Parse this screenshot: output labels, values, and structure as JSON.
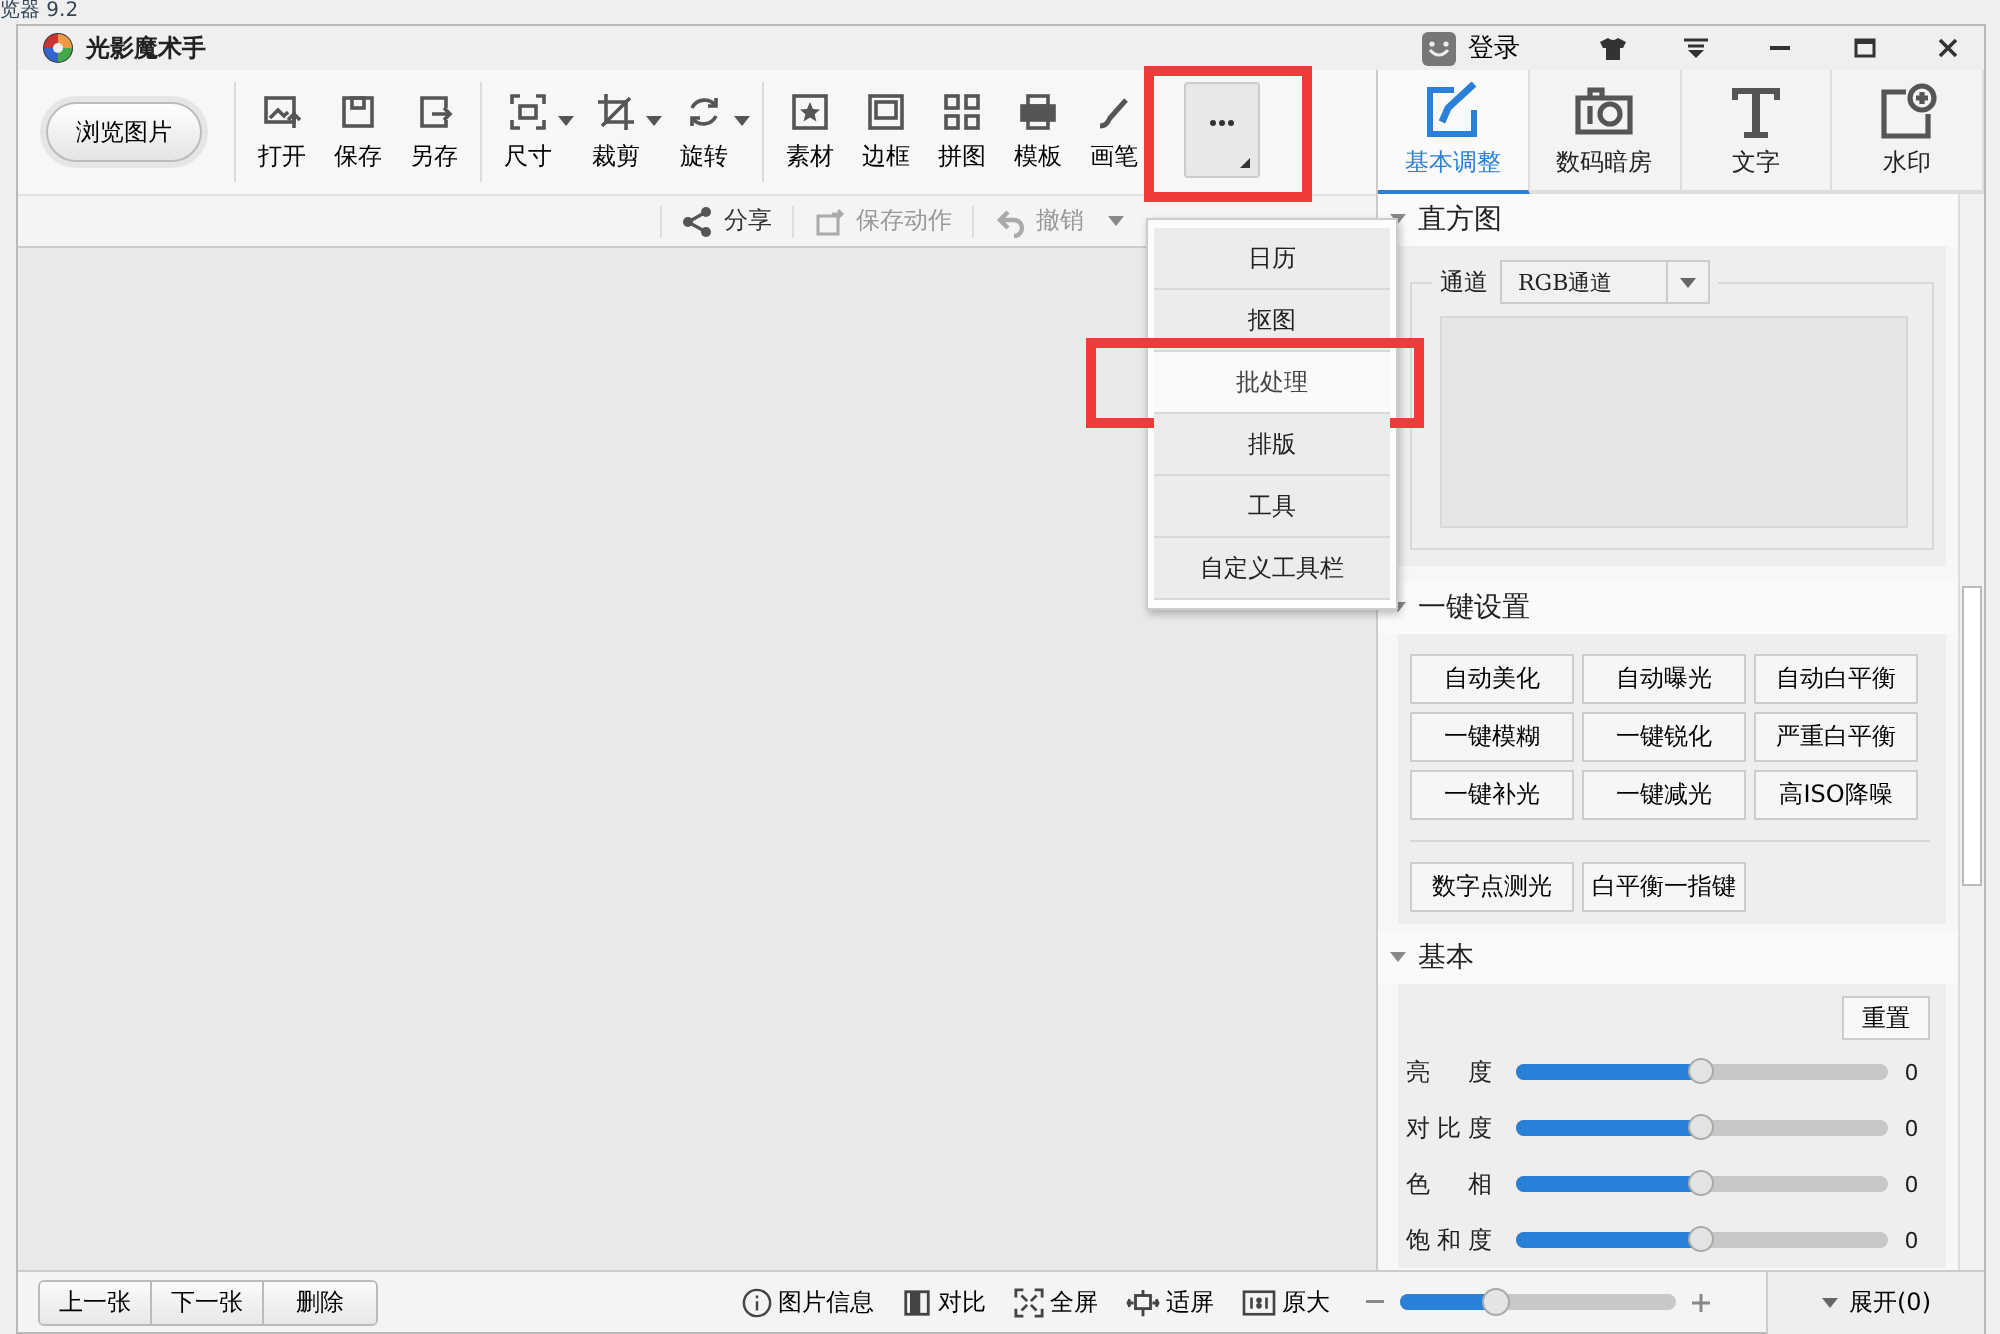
{
  "background_app": {
    "title_fragment": "览器 9.2"
  },
  "window": {
    "title": "光影魔术手",
    "login": "登录"
  },
  "browse_button": "浏览图片",
  "toolbar_groups": [
    [
      {
        "label": "打开",
        "kind": "open",
        "dropdown": false
      },
      {
        "label": "保存",
        "kind": "save",
        "dropdown": false
      },
      {
        "label": "另存",
        "kind": "saveas",
        "dropdown": false
      }
    ],
    [
      {
        "label": "尺寸",
        "kind": "size",
        "dropdown": true
      },
      {
        "label": "裁剪",
        "kind": "crop",
        "dropdown": true
      },
      {
        "label": "旋转",
        "kind": "rotate",
        "dropdown": true
      }
    ],
    [
      {
        "label": "素材",
        "kind": "star",
        "dropdown": false
      },
      {
        "label": "边框",
        "kind": "frame",
        "dropdown": false
      },
      {
        "label": "拼图",
        "kind": "grid",
        "dropdown": false
      },
      {
        "label": "模板",
        "kind": "printer",
        "dropdown": false
      },
      {
        "label": "画笔",
        "kind": "brush",
        "dropdown": false
      }
    ]
  ],
  "more_button": {
    "annotated": true
  },
  "side_tabs": [
    {
      "label": "基本调整",
      "kind": "edit",
      "selected": true
    },
    {
      "label": "数码暗房",
      "kind": "camera",
      "selected": false
    },
    {
      "label": "文字",
      "kind": "text",
      "selected": false
    },
    {
      "label": "水印",
      "kind": "watermark",
      "selected": false
    }
  ],
  "secondary_toolbar": [
    {
      "label": "分享",
      "kind": "share",
      "disabled": false,
      "dropdown": false
    },
    {
      "label": "保存动作",
      "kind": "saveaction",
      "disabled": true,
      "dropdown": false
    },
    {
      "label": "撤销",
      "kind": "undo",
      "disabled": true,
      "dropdown": true
    }
  ],
  "menu": [
    {
      "label": "日历",
      "hovered": false,
      "annotated": false
    },
    {
      "label": "抠图",
      "hovered": false,
      "annotated": false
    },
    {
      "label": "批处理",
      "hovered": true,
      "annotated": true
    },
    {
      "label": "排版",
      "hovered": false,
      "annotated": false
    },
    {
      "label": "工具",
      "hovered": false,
      "annotated": false
    },
    {
      "label": "自定义工具栏",
      "hovered": false,
      "annotated": false
    }
  ],
  "histogram": {
    "title": "直方图",
    "expanded": true,
    "channel_label": "通道",
    "channel_value": "RGB通道"
  },
  "quick_settings": {
    "title": "一键设置",
    "expanded": true,
    "buttons": [
      "自动美化",
      "自动曝光",
      "自动白平衡",
      "一键模糊",
      "一键锐化",
      "严重白平衡",
      "一键补光",
      "一键减光",
      "高ISO降噪"
    ],
    "extra_buttons": [
      "数字点测光",
      "白平衡一指键"
    ]
  },
  "basic": {
    "title": "基本",
    "expanded": true,
    "reset": "重置",
    "sliders": [
      {
        "label": "亮度",
        "level": 0.5,
        "value": "0"
      },
      {
        "label": "对比度",
        "level": 0.5,
        "value": "0"
      },
      {
        "label": "色相",
        "level": 0.5,
        "value": "0"
      },
      {
        "label": "饱和度",
        "level": 0.5,
        "value": "0"
      }
    ]
  },
  "bottom_bar": {
    "nav_buttons": [
      "上一张",
      "下一张",
      "删除"
    ],
    "tools": [
      {
        "label": "图片信息",
        "kind": "info"
      },
      {
        "label": "对比",
        "kind": "compare"
      },
      {
        "label": "全屏",
        "kind": "fullscreen"
      },
      {
        "label": "适屏",
        "kind": "fit"
      },
      {
        "label": "原大",
        "kind": "actual"
      }
    ],
    "zoom": {
      "level": 0.35
    },
    "expand": "展开(0)"
  }
}
